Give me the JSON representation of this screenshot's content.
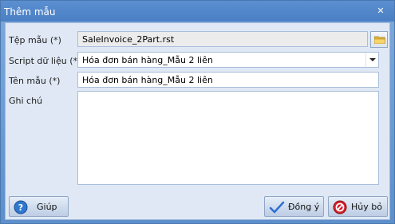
{
  "window": {
    "title": "Thêm mẫu",
    "close_glyph": "✕"
  },
  "form": {
    "template_file_label": "Tệp mẫu (*)",
    "template_file_value": "SaleInvoice_2Part.rst",
    "data_script_label": "Script dữ liệu (*)",
    "data_script_value": "Hóa đơn bán hàng_Mẫu 2 liên",
    "template_name_label": "Tên mẫu (*)",
    "template_name_value": "Hóa đơn bán hàng_Mẫu 2 liên",
    "notes_label": "Ghi chú",
    "notes_value": ""
  },
  "buttons": {
    "help": "Giúp",
    "ok": "Đồng ý",
    "cancel": "Hủy bỏ"
  },
  "icons": {
    "browse": "folder-icon",
    "dropdown": "chevron-down-icon",
    "help": "help-icon",
    "ok": "checkmark-icon",
    "cancel": "cancel-icon"
  },
  "colors": {
    "title_bar": "#4a7fc4",
    "client_bg": "#dfe8f4",
    "help_icon": "#2f78d0",
    "ok_icon": "#2e6fd6",
    "cancel_icon": "#d81e28"
  }
}
